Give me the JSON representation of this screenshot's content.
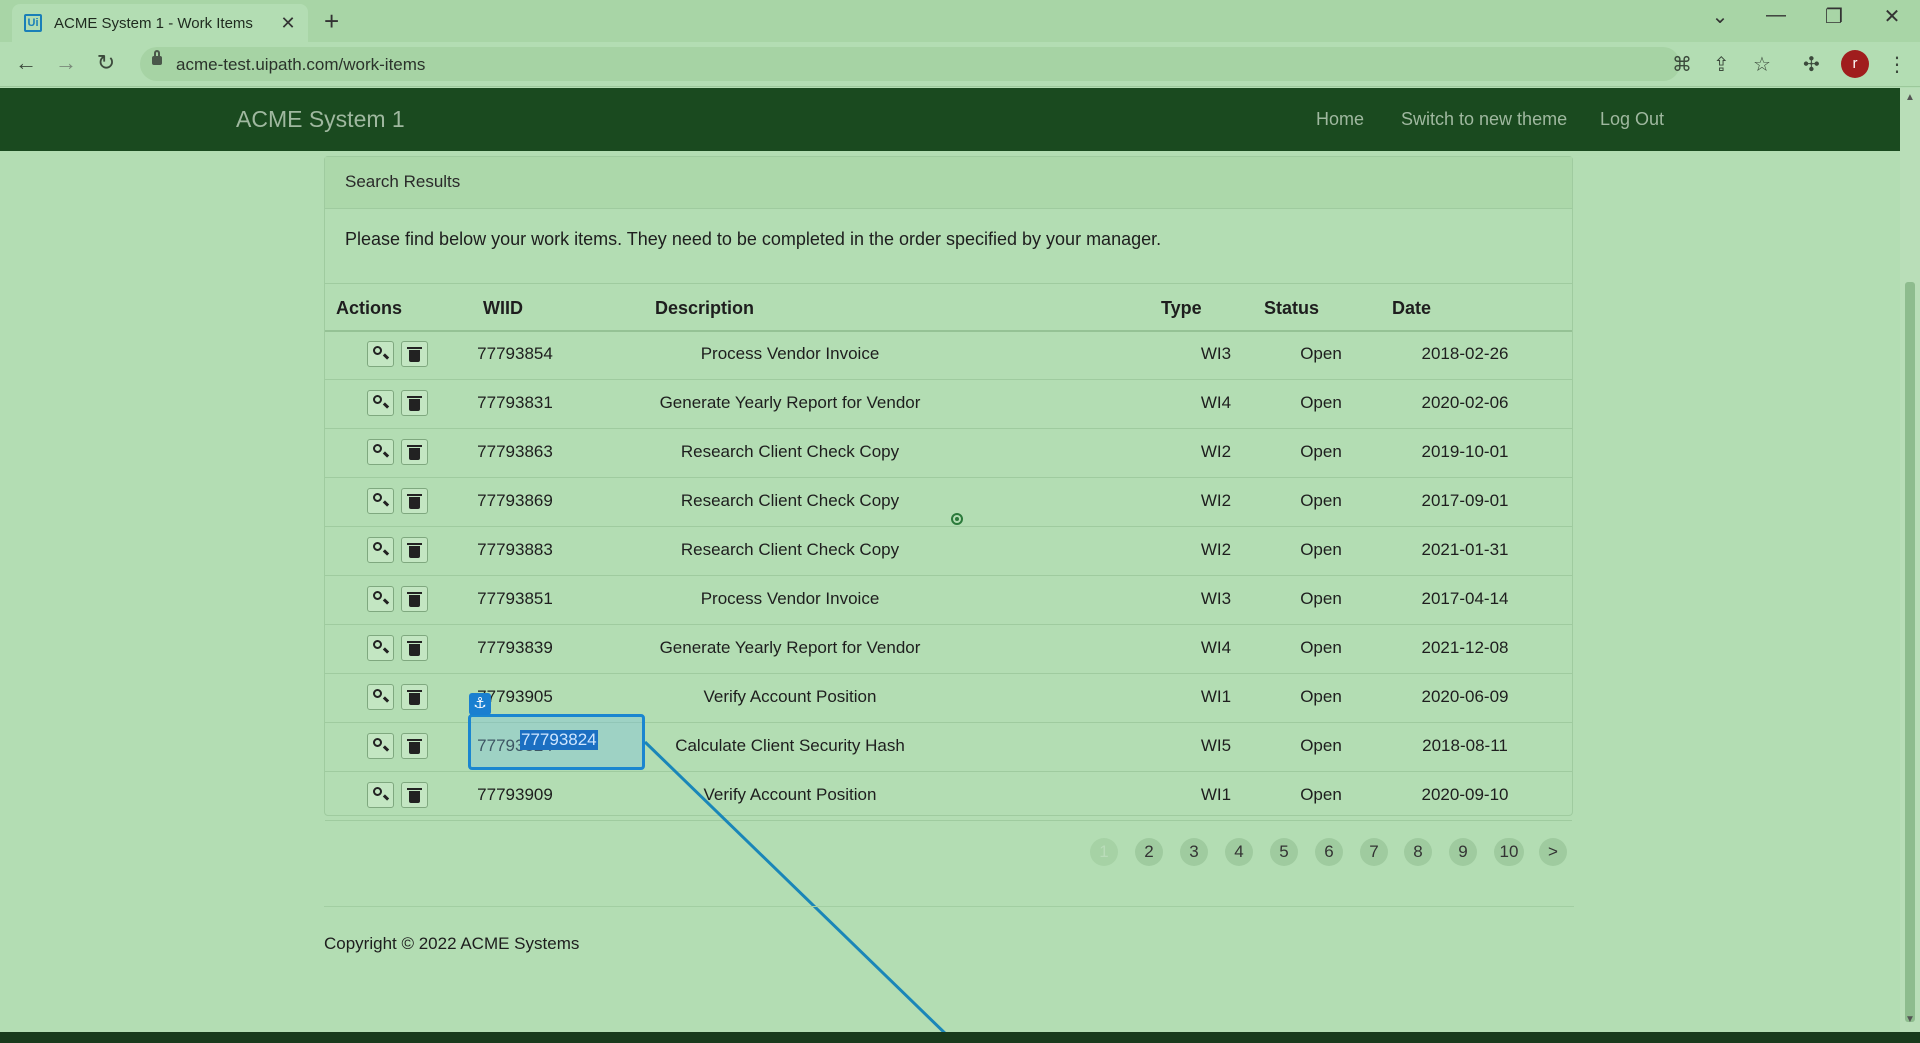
{
  "browser": {
    "tab_title": "ACME System 1 - Work Items",
    "tab_close": "✕",
    "new_tab": "+",
    "url": "acme-test.uipath.com/work-items",
    "profile_initial": "r"
  },
  "app": {
    "brand": "ACME System 1",
    "nav": [
      "Home",
      "Switch to new theme",
      "Log Out"
    ]
  },
  "panel": {
    "title": "Search Results",
    "intro": "Please find below your work items. They need to be completed in the order specified by your manager."
  },
  "table": {
    "headers": [
      "Actions",
      "WIID",
      "Description",
      "Type",
      "Status",
      "Date"
    ],
    "rows": [
      {
        "wiid": "77793854",
        "description": "Process Vendor Invoice",
        "type": "WI3",
        "status": "Open",
        "date": "2018-02-26"
      },
      {
        "wiid": "77793831",
        "description": "Generate Yearly Report for Vendor",
        "type": "WI4",
        "status": "Open",
        "date": "2020-02-06"
      },
      {
        "wiid": "77793863",
        "description": "Research Client Check Copy",
        "type": "WI2",
        "status": "Open",
        "date": "2019-10-01"
      },
      {
        "wiid": "77793869",
        "description": "Research Client Check Copy",
        "type": "WI2",
        "status": "Open",
        "date": "2017-09-01"
      },
      {
        "wiid": "77793883",
        "description": "Research Client Check Copy",
        "type": "WI2",
        "status": "Open",
        "date": "2021-01-31"
      },
      {
        "wiid": "77793851",
        "description": "Process Vendor Invoice",
        "type": "WI3",
        "status": "Open",
        "date": "2017-04-14"
      },
      {
        "wiid": "77793839",
        "description": "Generate Yearly Report for Vendor",
        "type": "WI4",
        "status": "Open",
        "date": "2021-12-08"
      },
      {
        "wiid": "77793905",
        "description": "Verify Account Position",
        "type": "WI1",
        "status": "Open",
        "date": "2020-06-09"
      },
      {
        "wiid": "77793824",
        "description": "Calculate Client Security Hash",
        "type": "WI5",
        "status": "Open",
        "date": "2018-08-11"
      },
      {
        "wiid": "77793909",
        "description": "Verify Account Position",
        "type": "WI1",
        "status": "Open",
        "date": "2020-09-10"
      }
    ]
  },
  "selection": {
    "highlighted_wiid": "77793824"
  },
  "pagination": [
    "1",
    "2",
    "3",
    "4",
    "5",
    "6",
    "7",
    "8",
    "9",
    "10",
    ">"
  ],
  "pagination_active": "1",
  "footer": "Copyright © 2022 ACME Systems",
  "colors": {
    "navbar": "#1a4a1f",
    "page_bg": "#b3ddb3",
    "selection": "#1a86d0"
  }
}
